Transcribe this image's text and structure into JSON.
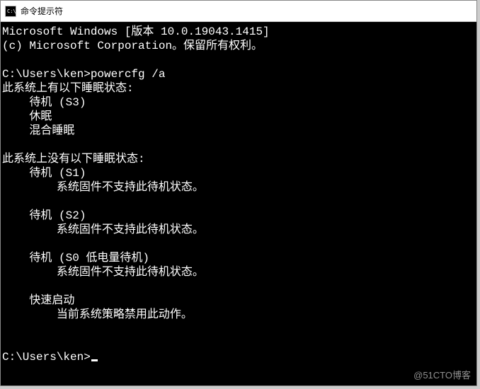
{
  "window": {
    "title": "命令提示符"
  },
  "terminal": {
    "lines": [
      "Microsoft Windows [版本 10.0.19043.1415]",
      "(c) Microsoft Corporation。保留所有权利。",
      "",
      "C:\\Users\\ken>powercfg /a",
      "此系统上有以下睡眠状态:",
      "    待机 (S3)",
      "    休眠",
      "    混合睡眠",
      "",
      "此系统上没有以下睡眠状态:",
      "    待机 (S1)",
      "        系统固件不支持此待机状态。",
      "",
      "    待机 (S2)",
      "        系统固件不支持此待机状态。",
      "",
      "    待机 (S0 低电量待机)",
      "        系统固件不支持此待机状态。",
      "",
      "    快速启动",
      "        当前系统策略禁用此动作。",
      "",
      ""
    ],
    "prompt_final": "C:\\Users\\ken>"
  },
  "watermark": "@51CTO博客"
}
